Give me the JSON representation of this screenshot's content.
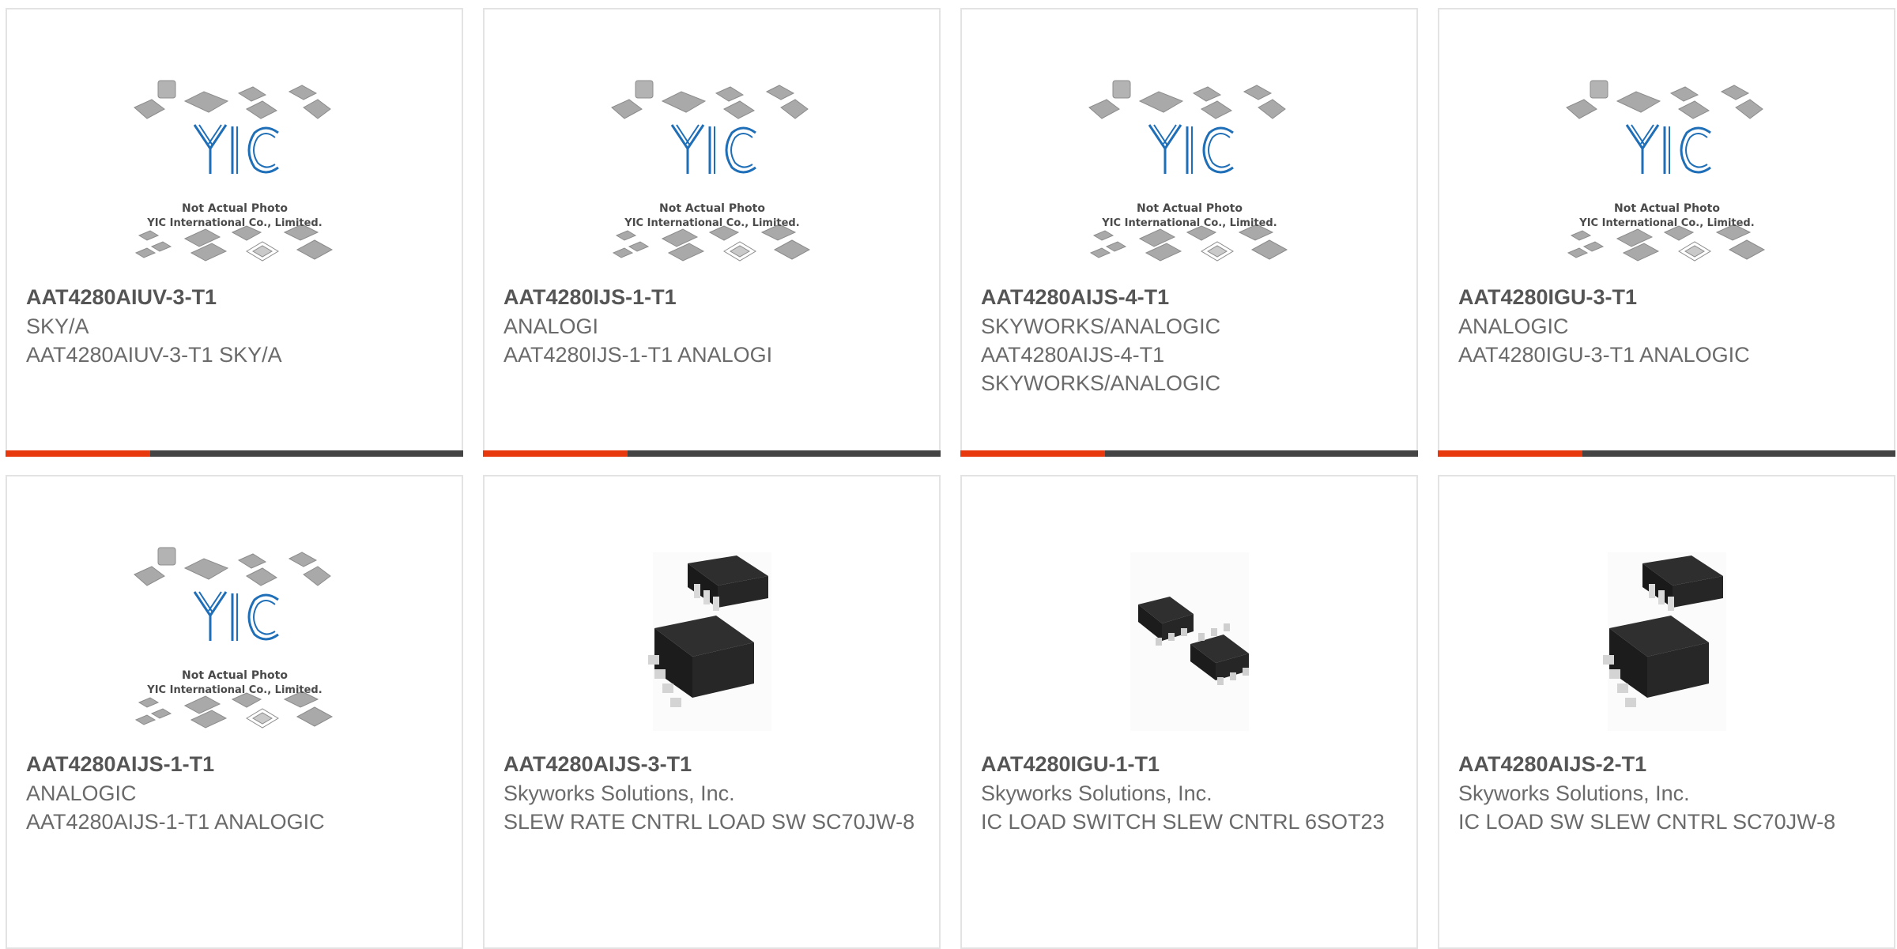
{
  "colors": {
    "accent": "#e8380d",
    "bar": "#444444",
    "border": "#e3e3e3",
    "logo": "#1f6fb8"
  },
  "products": [
    {
      "part_number": "AAT4280AIUV-3-T1",
      "manufacturer": "SKY/A",
      "description": "AAT4280AIUV-3-T1 SKY/A",
      "image": "yic-placeholder",
      "photo_text_1": "Not Actual Photo",
      "photo_text_2": "YIC International Co., Limited."
    },
    {
      "part_number": "AAT4280IJS-1-T1",
      "manufacturer": "ANALOGI",
      "description": "AAT4280IJS-1-T1 ANALOGI",
      "image": "yic-placeholder",
      "photo_text_1": "Not Actual Photo",
      "photo_text_2": "YIC International Co., Limited."
    },
    {
      "part_number": "AAT4280AIJS-4-T1",
      "manufacturer": "SKYWORKS/ANALOGIC",
      "description": "AAT4280AIJS-4-T1 SKYWORKS/ANALOGIC",
      "image": "yic-placeholder",
      "photo_text_1": "Not Actual Photo",
      "photo_text_2": "YIC International Co., Limited."
    },
    {
      "part_number": "AAT4280IGU-3-T1",
      "manufacturer": "ANALOGIC",
      "description": "AAT4280IGU-3-T1 ANALOGIC",
      "image": "yic-placeholder",
      "photo_text_1": "Not Actual Photo",
      "photo_text_2": "YIC International Co., Limited."
    },
    {
      "part_number": "AAT4280AIJS-1-T1",
      "manufacturer": "ANALOGIC",
      "description": "AAT4280AIJS-1-T1 ANALOGIC",
      "image": "yic-placeholder",
      "photo_text_1": "Not Actual Photo",
      "photo_text_2": "YIC International Co., Limited."
    },
    {
      "part_number": "AAT4280AIJS-3-T1",
      "manufacturer": "Skyworks Solutions, Inc.",
      "description": "SLEW RATE CNTRL LOAD SW SC70JW-8",
      "image": "ic-chip-8pin"
    },
    {
      "part_number": "AAT4280IGU-1-T1",
      "manufacturer": "Skyworks Solutions, Inc.",
      "description": "IC LOAD SWITCH SLEW CNTRL 6SOT23",
      "image": "ic-chip-sot23"
    },
    {
      "part_number": "AAT4280AIJS-2-T1",
      "manufacturer": "Skyworks Solutions, Inc.",
      "description": "IC LOAD SW SLEW CNTRL SC70JW-8",
      "image": "ic-chip-8pin"
    }
  ]
}
